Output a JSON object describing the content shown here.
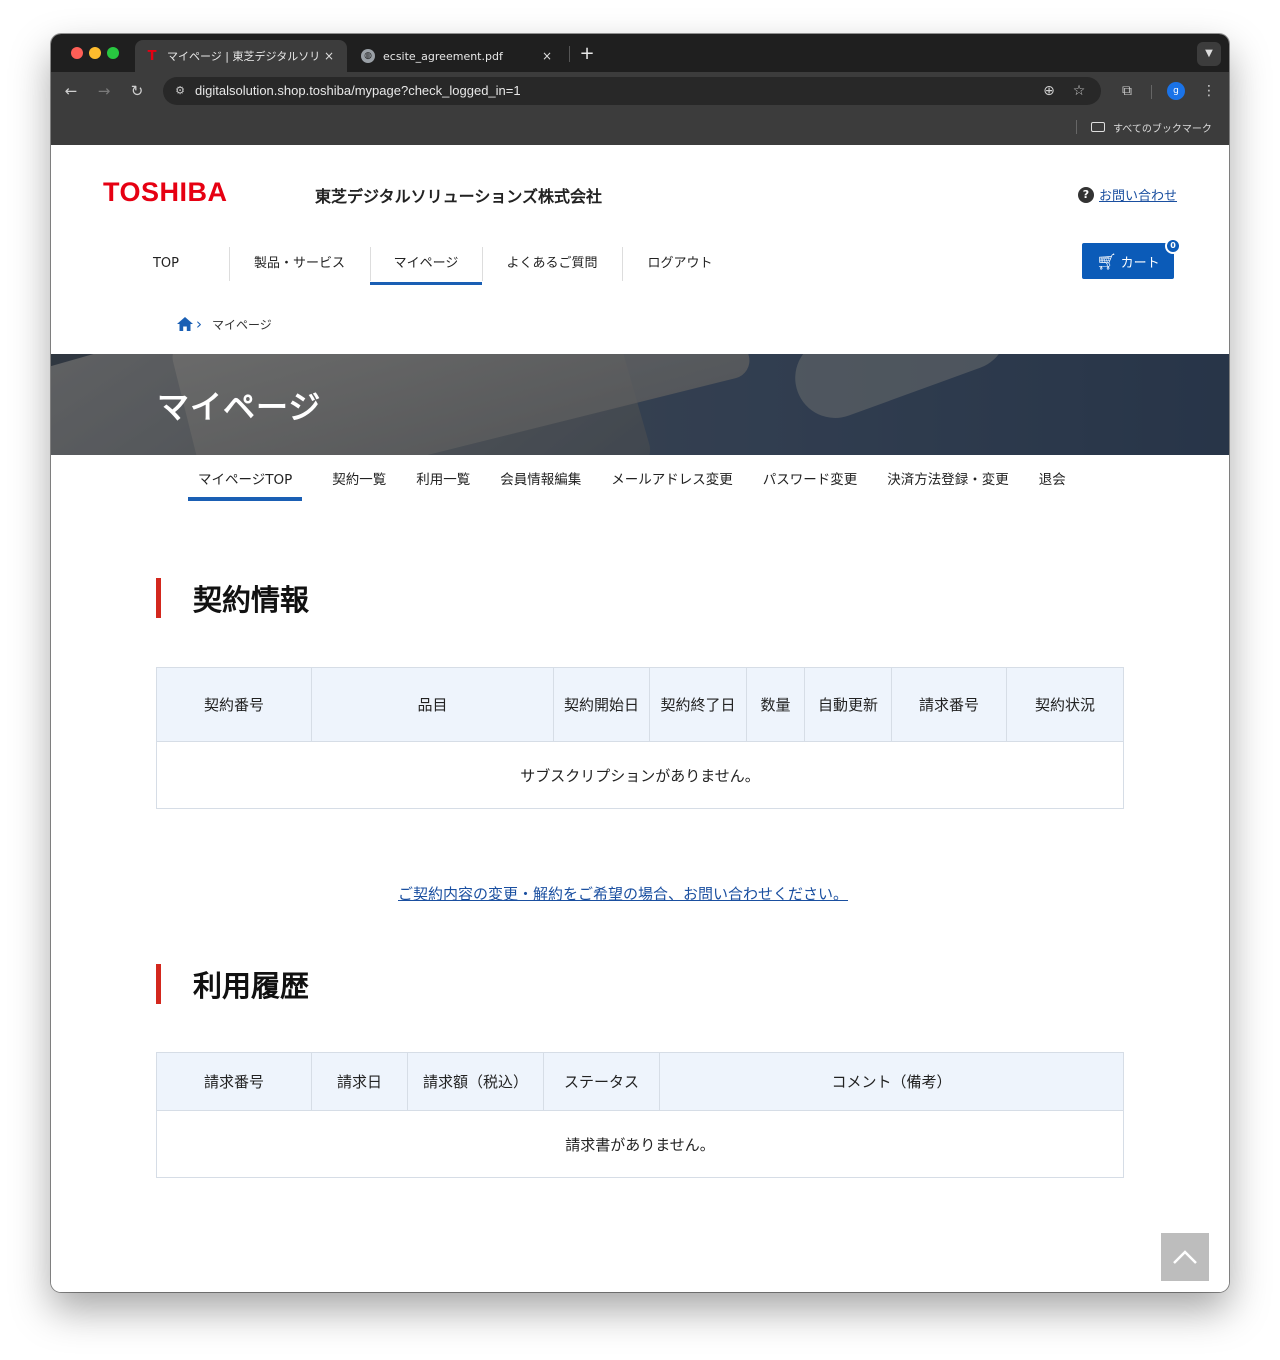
{
  "browser": {
    "tabs": [
      {
        "title": "マイページ | 東芝デジタルソリュ",
        "close": "×"
      },
      {
        "title": "ecsite_agreement.pdf",
        "close": "×"
      }
    ],
    "new_tab": "+",
    "url": "digitalsolution.shop.toshiba/mypage?check_logged_in=1",
    "profile_initial": "g",
    "bookmarks_label": "すべてのブックマーク",
    "favicon_letter": "T"
  },
  "header": {
    "logo": "TOSHIBA",
    "company": "東芝デジタルソリューションズ株式会社",
    "contact_label": "お問い合わせ",
    "contact_icon_glyph": "?",
    "cart_label": "カート",
    "cart_count": "0"
  },
  "mainnav": [
    {
      "label": "TOP",
      "width": 126
    },
    {
      "label": "製品・サービス",
      "width": 141
    },
    {
      "label": "マイページ",
      "width": 112,
      "current": true
    },
    {
      "label": "よくあるご質問",
      "width": 140
    },
    {
      "label": "ログアウト",
      "width": 116
    }
  ],
  "breadcrumb": {
    "current": "マイページ"
  },
  "hero": {
    "title": "マイページ"
  },
  "subnav": [
    {
      "label": "マイページTOP",
      "current": true
    },
    {
      "label": "契約一覧"
    },
    {
      "label": "利用一覧"
    },
    {
      "label": "会員情報編集"
    },
    {
      "label": "メールアドレス変更"
    },
    {
      "label": "パスワード変更"
    },
    {
      "label": "決済方法登録・変更"
    },
    {
      "label": "退会"
    }
  ],
  "contracts": {
    "heading": "契約情報",
    "columns": [
      "契約番号",
      "品目",
      "契約開始日",
      "契約終了日",
      "数量",
      "自動更新",
      "請求番号",
      "契約状況"
    ],
    "empty_message": "サブスクリプションがありません。"
  },
  "change_link": "ご契約内容の変更・解約をご希望の場合、お問い合わせください。",
  "usage": {
    "heading": "利用履歴",
    "columns": [
      "請求番号",
      "請求日",
      "請求額（税込）",
      "ステータス",
      "コメント（備考）"
    ],
    "empty_message": "請求書がありません。"
  },
  "colors": {
    "brand_red": "#e60012",
    "accent_blue": "#1a5fb4",
    "heading_bar": "#d3271d",
    "table_header_bg": "#eef4fc"
  }
}
